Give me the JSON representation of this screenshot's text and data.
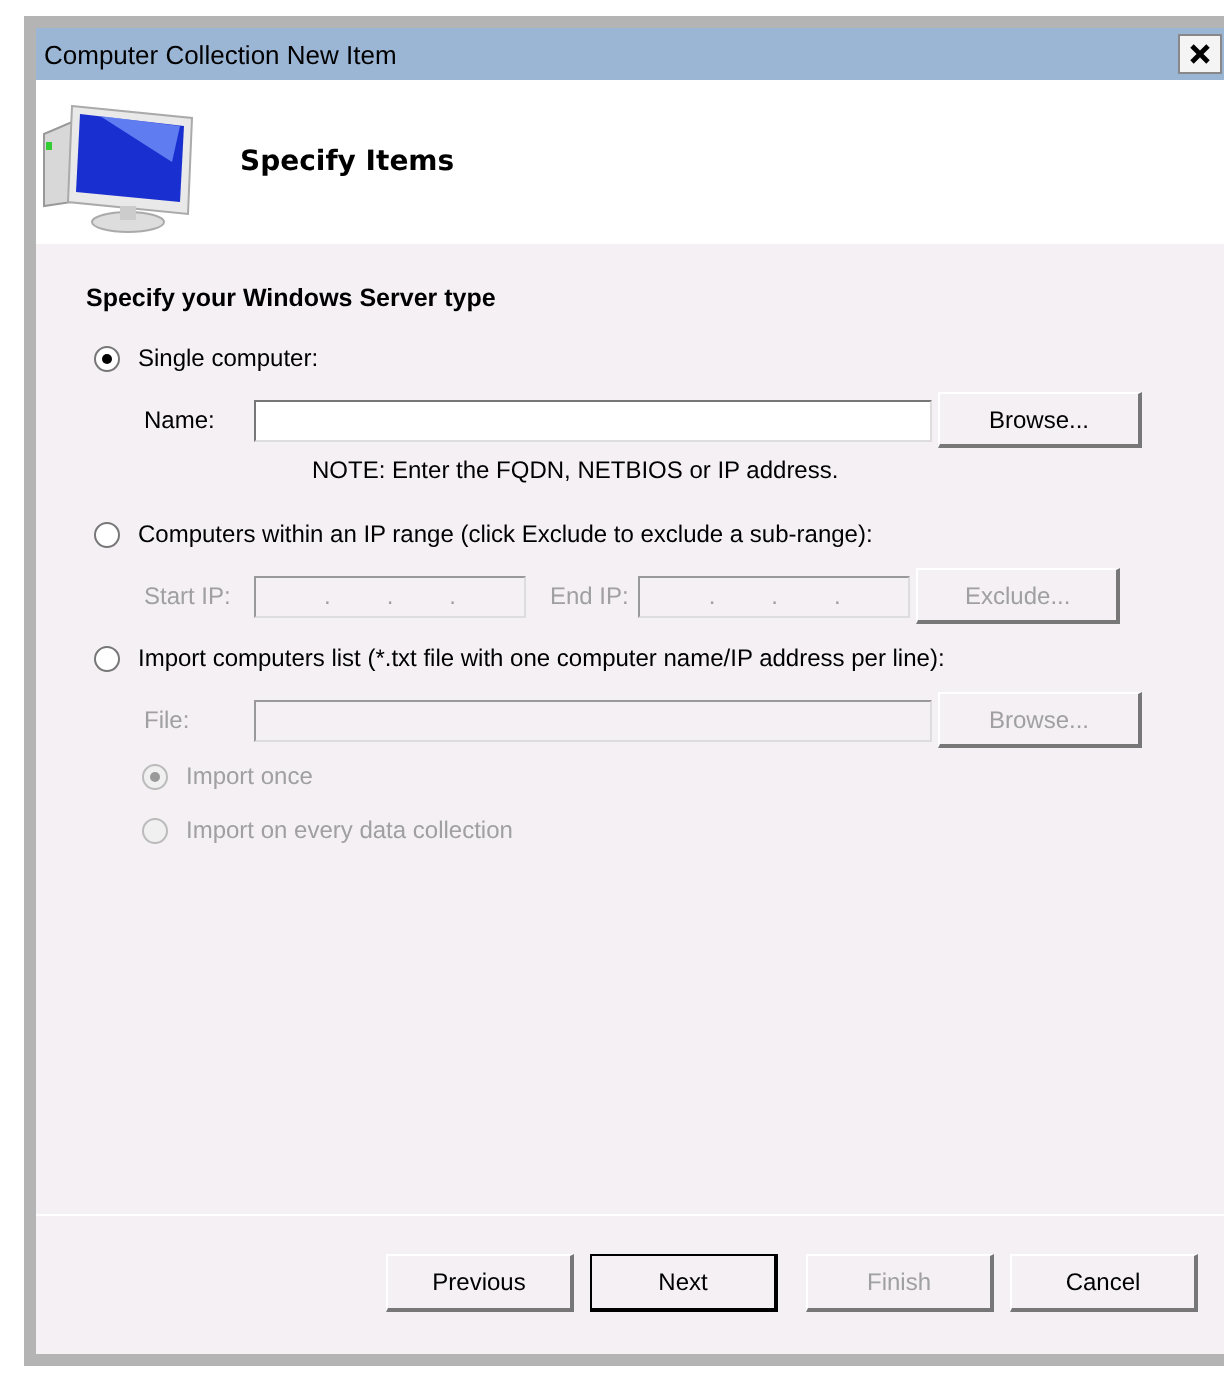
{
  "window": {
    "title": "Computer Collection New Item"
  },
  "header": {
    "title": "Specify Items"
  },
  "section": {
    "title": "Specify your Windows Server type"
  },
  "rows": [
    {
      "kind": "radio",
      "label": "Single computer:",
      "selected": true,
      "disabled": false,
      "indent": false
    },
    {
      "kind": "text-field",
      "label": "Name:",
      "disabled": false,
      "button": {
        "label": "Browse...",
        "disabled": false
      }
    },
    {
      "kind": "note",
      "text": "NOTE: Enter the FQDN, NETBIOS or IP address."
    },
    {
      "kind": "radio",
      "label": "Computers within an IP range (click Exclude to exclude a sub-range):",
      "selected": false,
      "disabled": false,
      "indent": false
    },
    {
      "kind": "ip-range",
      "start_label": "Start IP:",
      "end_label": "End IP:",
      "separator": ".",
      "disabled": true,
      "button": {
        "label": "Exclude...",
        "disabled": true
      }
    },
    {
      "kind": "radio",
      "label": "Import computers list (*.txt file with one computer name/IP address per line):",
      "selected": false,
      "disabled": false,
      "indent": false
    },
    {
      "kind": "text-field",
      "label": "File:",
      "disabled": true,
      "button": {
        "label": "Browse...",
        "disabled": true
      }
    },
    {
      "kind": "radio",
      "label": "Import once",
      "selected": true,
      "disabled": true,
      "indent": true
    },
    {
      "kind": "radio",
      "label": "Import on every data collection",
      "selected": false,
      "disabled": true,
      "indent": true
    }
  ],
  "buttons": [
    {
      "label": "Previous",
      "disabled": false,
      "default": false
    },
    {
      "label": "Next",
      "disabled": false,
      "default": true
    },
    {
      "label": "Finish",
      "disabled": true,
      "default": false
    },
    {
      "label": "Cancel",
      "disabled": false,
      "default": false
    }
  ]
}
